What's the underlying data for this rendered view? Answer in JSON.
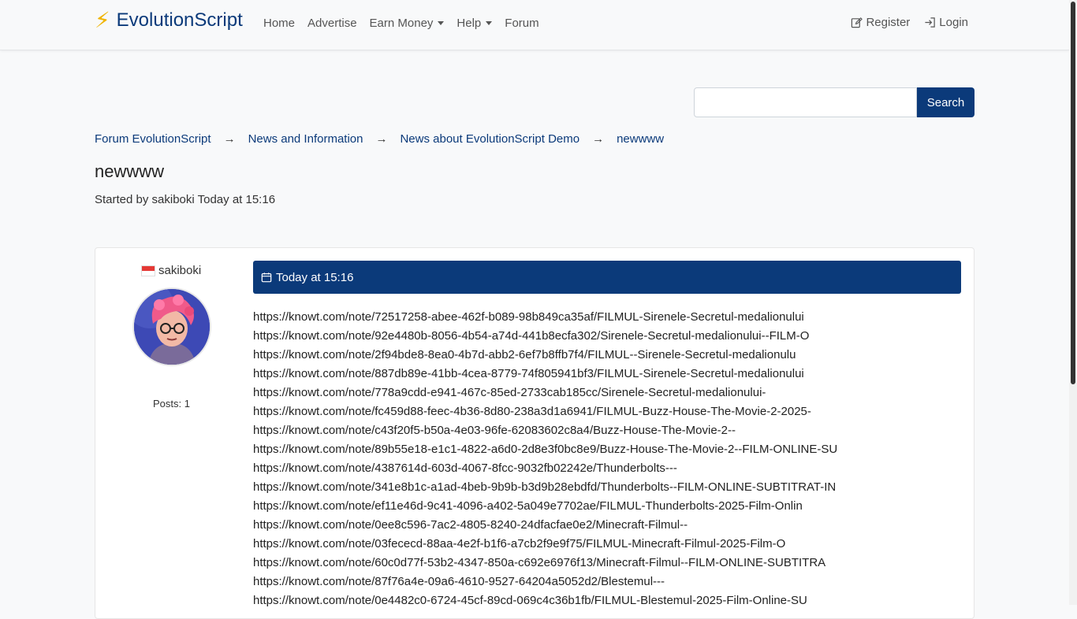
{
  "brand": {
    "name": "EvolutionScript",
    "bolt_icon": "lightning-icon"
  },
  "nav": {
    "home": "Home",
    "advertise": "Advertise",
    "earn_money": "Earn Money",
    "help": "Help",
    "forum": "Forum",
    "register": "Register",
    "login": "Login"
  },
  "search": {
    "value": "",
    "button": "Search"
  },
  "breadcrumb": {
    "items": [
      "Forum EvolutionScript",
      "News and Information",
      "News about EvolutionScript Demo",
      "newwww"
    ],
    "separator": "→"
  },
  "thread": {
    "title": "newwww",
    "started_by": "Started by sakiboki Today at 15:16"
  },
  "post": {
    "author": "sakiboki",
    "posts_label": "Posts: 1",
    "date": "Today at 15:16",
    "links": [
      "https://knowt.com/note/72517258-abee-462f-b089-98b849ca35af/FILMUL-Sirenele-Secretul-medalionului",
      "https://knowt.com/note/92e4480b-8056-4b54-a74d-441b8ecfa302/Sirenele-Secretul-medalionului--FILM-O",
      "https://knowt.com/note/2f94bde8-8ea0-4b7d-abb2-6ef7b8ffb7f4/FILMUL--Sirenele-Secretul-medalionulu",
      "https://knowt.com/note/887db89e-41bb-4cea-8779-74f805941bf3/FILMUL-Sirenele-Secretul-medalionului",
      "https://knowt.com/note/778a9cdd-e941-467c-85ed-2733cab185cc/Sirenele-Secretul-medalionului-",
      "https://knowt.com/note/fc459d88-feec-4b36-8d80-238a3d1a6941/FILMUL-Buzz-House-The-Movie-2-2025-",
      "https://knowt.com/note/c43f20f5-b50a-4e03-96fe-62083602c8a4/Buzz-House-The-Movie-2--",
      "https://knowt.com/note/89b55e18-e1c1-4822-a6d0-2d8e3f0bc8e9/Buzz-House-The-Movie-2--FILM-ONLINE-SU",
      "https://knowt.com/note/4387614d-603d-4067-8fcc-9032fb02242e/Thunderbolts---",
      "https://knowt.com/note/341e8b1c-a1ad-4beb-9b9b-b3d9b28ebdfd/Thunderbolts--FILM-ONLINE-SUBTITRAT-IN",
      "https://knowt.com/note/ef11e46d-9c41-4096-a402-5a049e7702ae/FILMUL-Thunderbolts-2025-Film-Onlin",
      "https://knowt.com/note/0ee8c596-7ac2-4805-8240-24dfacfae0e2/Minecraft-Filmul--",
      "https://knowt.com/note/03fececd-88aa-4e2f-b1f6-a7cb2f9e9f75/FILMUL-Minecraft-Filmul-2025-Film-O",
      "https://knowt.com/note/60c0d77f-53b2-4347-850a-c692e6976f13/Minecraft-Filmul--FILM-ONLINE-SUBTITRA",
      "https://knowt.com/note/87f76a4e-09a6-4610-9527-64204a5052d2/Blestemul---",
      "https://knowt.com/note/0e4482c0-6724-45cf-89cd-069c4c36b1fb/FILMUL-Blestemul-2025-Film-Online-SU"
    ]
  },
  "colors": {
    "primary": "#0b3a7a",
    "bolt": "#f0b400"
  }
}
